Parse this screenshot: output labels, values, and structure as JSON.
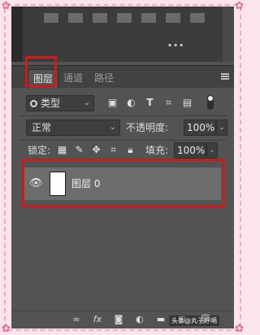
{
  "panel": {
    "top_dots": "...",
    "tabs": [
      {
        "label": "图层"
      },
      {
        "label": "通道"
      },
      {
        "label": "路径"
      }
    ]
  },
  "filter": {
    "kind_label": "类型",
    "icons": [
      "image-filter-icon",
      "adjustment-filter-icon",
      "type-filter-icon",
      "shape-filter-icon",
      "smart-object-filter-icon"
    ]
  },
  "blend": {
    "mode": "正常",
    "opacity_label": "不透明度:",
    "opacity_value": "100%"
  },
  "lock": {
    "label": "锁定:",
    "fill_label": "填充:",
    "fill_value": "100%"
  },
  "layer": {
    "name": "图层 0"
  },
  "watermark": "头条@丸子呼嗝",
  "colors": {
    "highlight": "#cc1b1b",
    "panel_bg": "#535353",
    "frame_pink": "#f4a8c2"
  }
}
